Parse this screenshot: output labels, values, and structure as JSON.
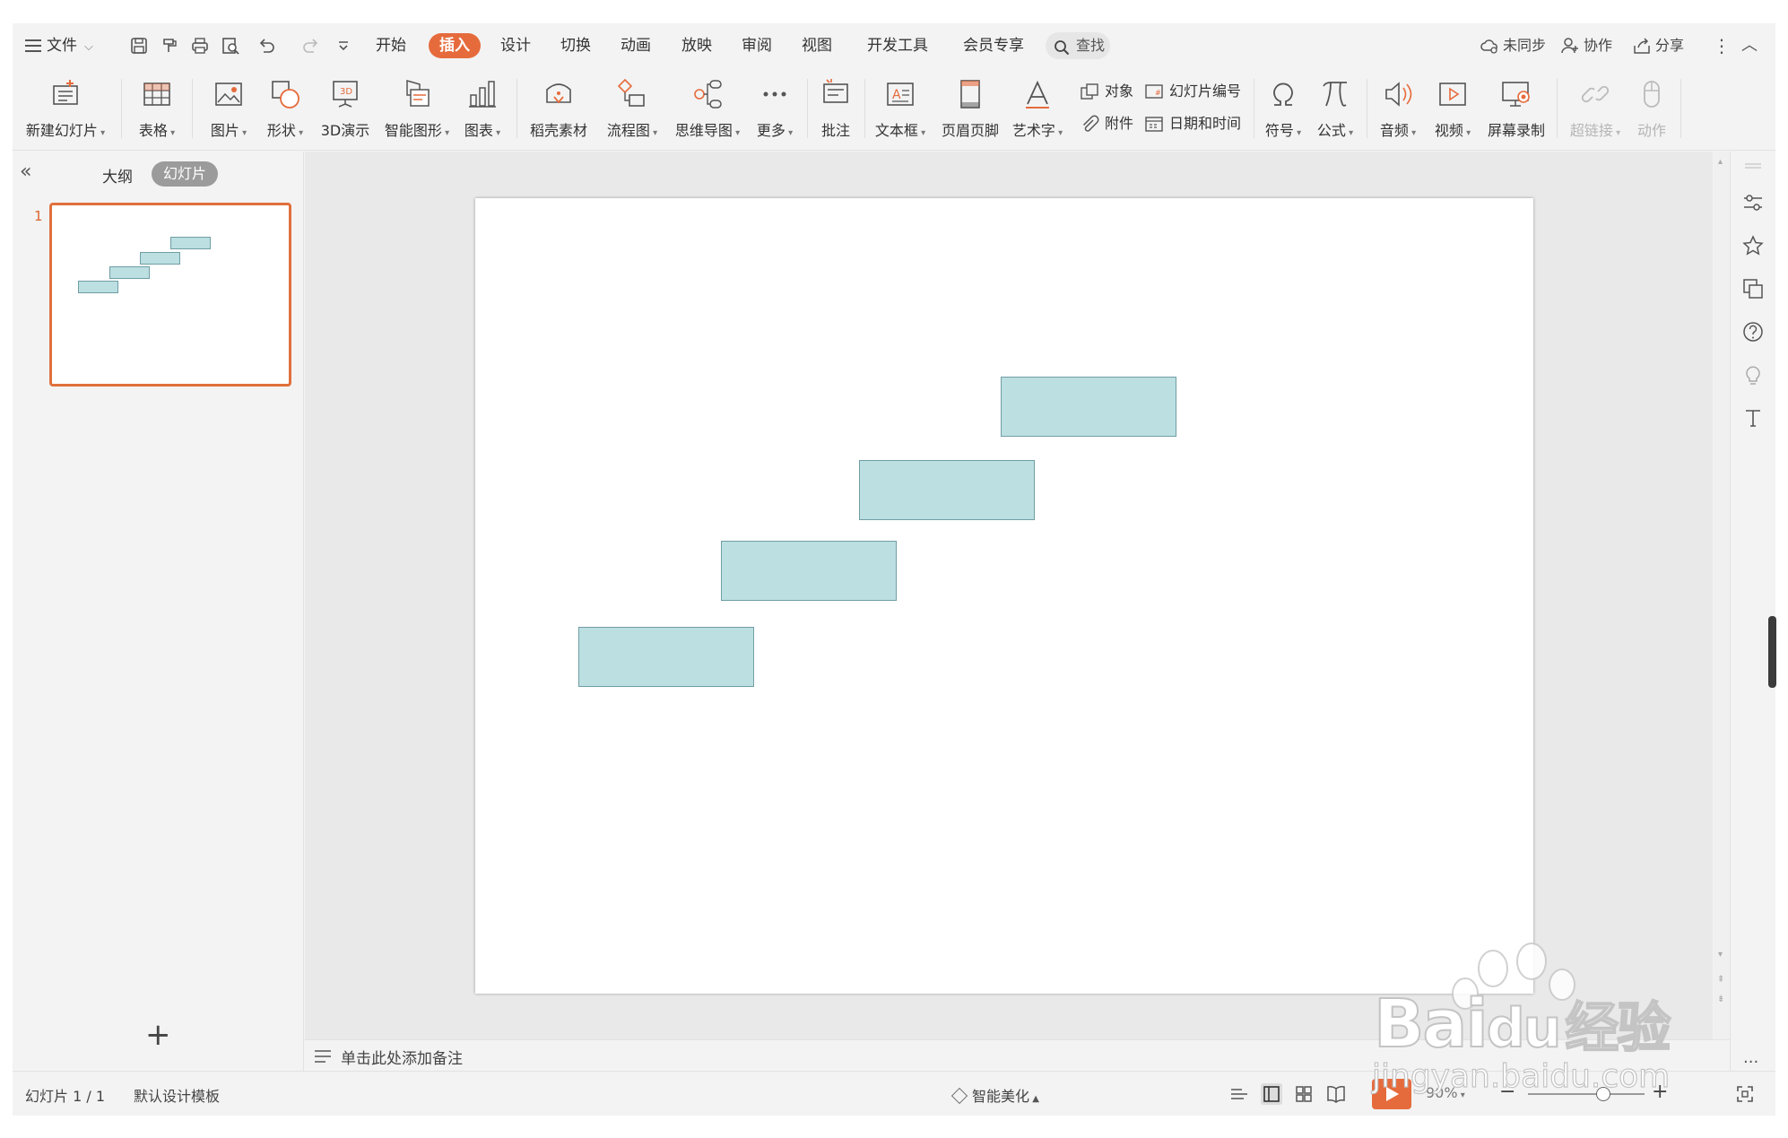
{
  "menu": {
    "file": "文件"
  },
  "tabs": [
    "开始",
    "插入",
    "设计",
    "切换",
    "动画",
    "放映",
    "审阅",
    "视图",
    "开发工具",
    "会员专享"
  ],
  "active_tab": "插入",
  "search": {
    "label": "查找"
  },
  "topright": {
    "sync": "未同步",
    "collab": "协作",
    "share": "分享"
  },
  "ribbon": {
    "new_slide": "新建幻灯片",
    "table": "表格",
    "picture": "图片",
    "shape": "形状",
    "demo3d": "3D演示",
    "smartart": "智能图形",
    "chart": "图表",
    "docer": "稻壳素材",
    "flowchart": "流程图",
    "mindmap": "思维导图",
    "more": "更多",
    "comment": "批注",
    "textbox": "文本框",
    "header_footer": "页眉页脚",
    "wordart": "艺术字",
    "object": "对象",
    "attachment": "附件",
    "slide_number": "幻灯片编号",
    "datetime": "日期和时间",
    "symbol": "符号",
    "formula": "公式",
    "audio": "音频",
    "video": "视频",
    "screen_record": "屏幕录制",
    "hyperlink": "超链接",
    "action": "动作"
  },
  "left_panel": {
    "outline": "大纲",
    "slides": "幻灯片",
    "slide_number": "1"
  },
  "notes": {
    "placeholder": "单击此处添加备注"
  },
  "status": {
    "slide_info": "幻灯片 1 / 1",
    "template": "默认设计模板",
    "beautify": "智能美化",
    "zoom": "90%"
  },
  "shape_color": "#bcdfe2",
  "accent_color": "#e66b3c",
  "watermark": {
    "brand": "Bai",
    "brand2": "du",
    "product": "经验",
    "url": "jingyan.baidu.com"
  }
}
